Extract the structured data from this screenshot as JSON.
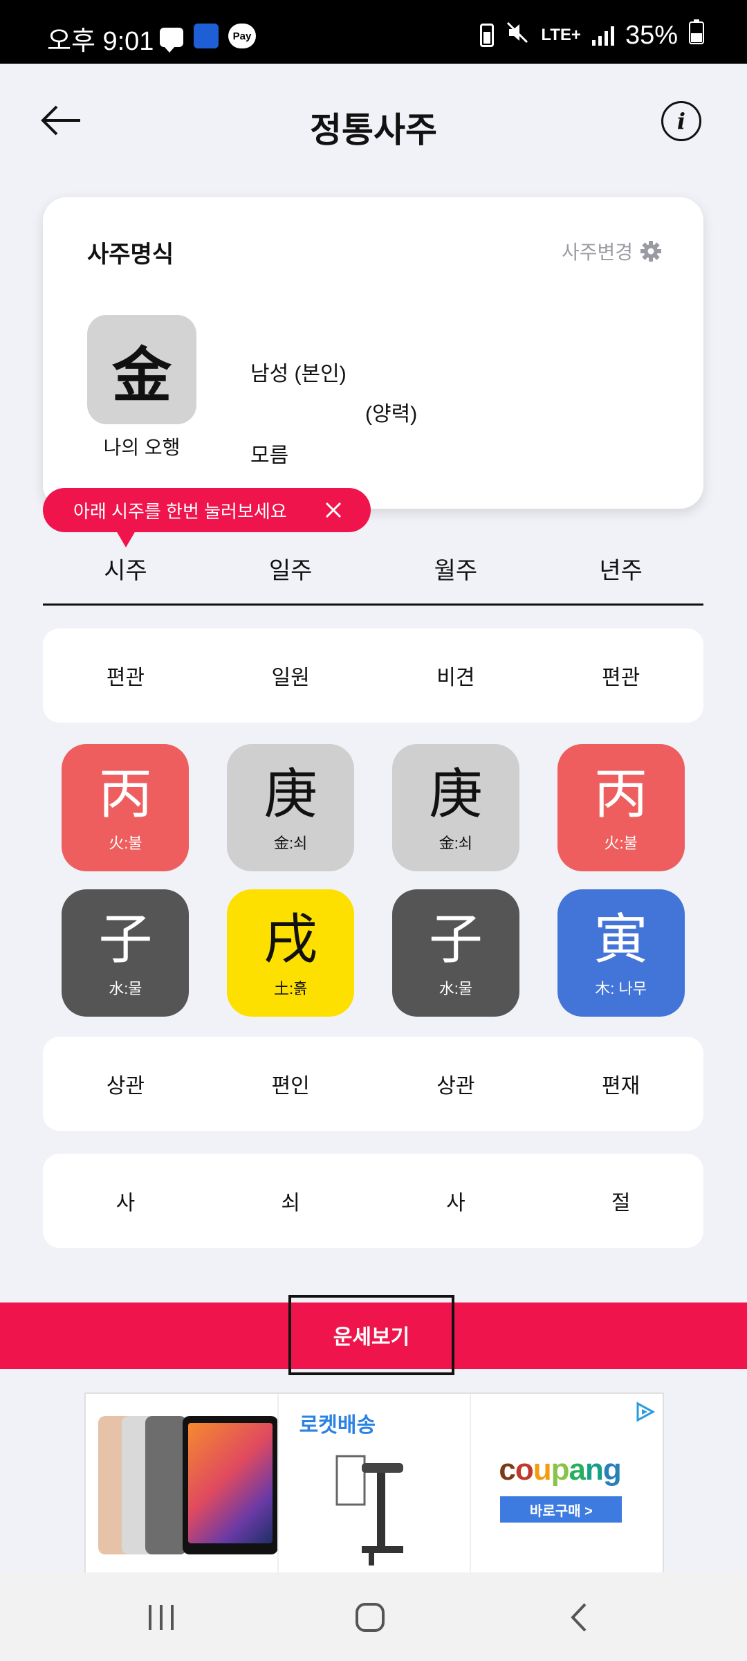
{
  "status_bar": {
    "time": "오후 9:01",
    "pay_label": "Pay",
    "network": "LTE+",
    "battery": "35%"
  },
  "header": {
    "title": "정통사주"
  },
  "card": {
    "title": "사주명식",
    "change_label": "사주변경",
    "element_char": "金",
    "element_label": "나의 오행",
    "gender": "남성 (본인)",
    "calendar": "(양력)",
    "birth_time": "모름"
  },
  "tooltip": {
    "text": "아래 시주를 한번 눌러보세요"
  },
  "tabs": [
    "시주",
    "일주",
    "월주",
    "년주"
  ],
  "ten_gods_top": [
    "편관",
    "일원",
    "비견",
    "편관"
  ],
  "stems": [
    {
      "char": "丙",
      "label": "火:불",
      "color": "#ee5e5e"
    },
    {
      "char": "庚",
      "label": "金:쇠",
      "color": "#cfcfcf"
    },
    {
      "char": "庚",
      "label": "金:쇠",
      "color": "#cfcfcf"
    },
    {
      "char": "丙",
      "label": "火:불",
      "color": "#ee5e5e"
    }
  ],
  "branches": [
    {
      "char": "子",
      "label": "水:물",
      "color": "#555555"
    },
    {
      "char": "戌",
      "label": "土:흙",
      "color": "#fddf00"
    },
    {
      "char": "子",
      "label": "水:물",
      "color": "#555555"
    },
    {
      "char": "寅",
      "label": "木: 나무",
      "color": "#4374d7"
    }
  ],
  "ten_gods_bottom": [
    "상관",
    "편인",
    "상관",
    "편재"
  ],
  "twelve_stages": [
    "사",
    "쇠",
    "사",
    "절"
  ],
  "action": {
    "label": "운세보기",
    "color": "#f0144d"
  },
  "ad": {
    "rocket_label": "로켓배송",
    "brand": "coupang",
    "buy_label": "바로구매 >"
  }
}
